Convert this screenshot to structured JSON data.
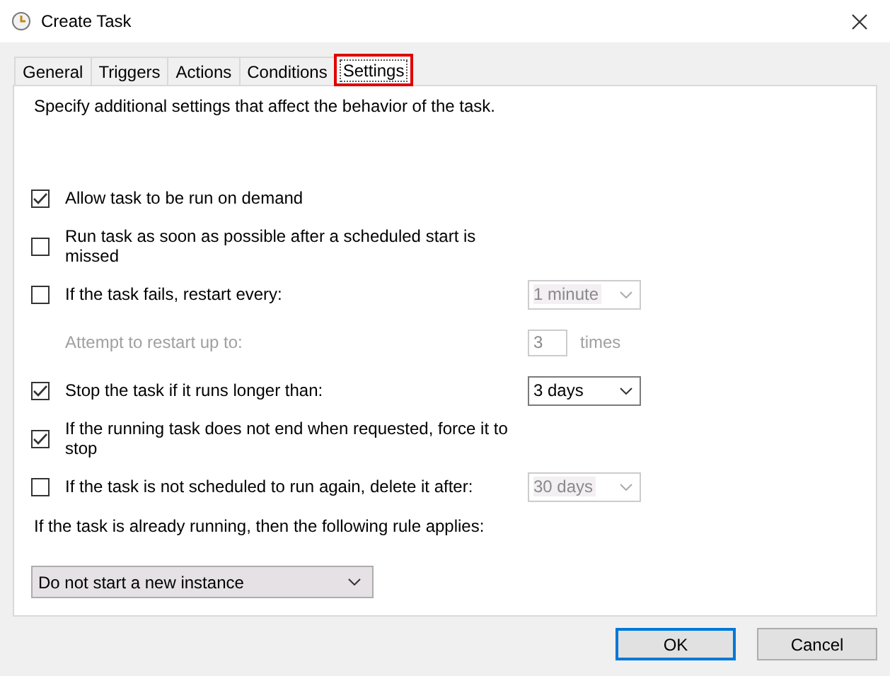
{
  "window": {
    "title": "Create Task"
  },
  "tabs": [
    {
      "label": "General",
      "selected": false
    },
    {
      "label": "Triggers",
      "selected": false
    },
    {
      "label": "Actions",
      "selected": false
    },
    {
      "label": "Conditions",
      "selected": false
    },
    {
      "label": "Settings",
      "selected": true
    }
  ],
  "description": "Specify additional settings that affect the behavior of the task.",
  "settings": [
    {
      "kind": "checkbox",
      "label": "Allow task to be run on demand",
      "checked": true
    },
    {
      "kind": "checkbox",
      "label": "Run task as soon as possible after a scheduled start is missed",
      "checked": false
    },
    {
      "kind": "checkbox",
      "label": "If the task fails, restart every:",
      "checked": false,
      "dropdown": {
        "value": "1 minute",
        "disabled": true
      }
    },
    {
      "kind": "number",
      "label": "Attempt to restart up to:",
      "disabled": true,
      "value": "3",
      "unit": "times"
    },
    {
      "kind": "checkbox",
      "label": "Stop the task if it runs longer than:",
      "checked": true,
      "dropdown": {
        "value": "3 days",
        "disabled": false
      }
    },
    {
      "kind": "checkbox",
      "label": "If the running task does not end when requested, force it to stop",
      "checked": true
    },
    {
      "kind": "checkbox",
      "label": "If the task is not scheduled to run again, delete it after:",
      "checked": false,
      "dropdown": {
        "value": "30 days",
        "disabled": true
      }
    }
  ],
  "rule": {
    "label": "If the task is already running, then the following rule applies:",
    "value": "Do not start a new instance"
  },
  "buttons": [
    {
      "label": "OK",
      "default": true
    },
    {
      "label": "Cancel",
      "default": false
    }
  ]
}
